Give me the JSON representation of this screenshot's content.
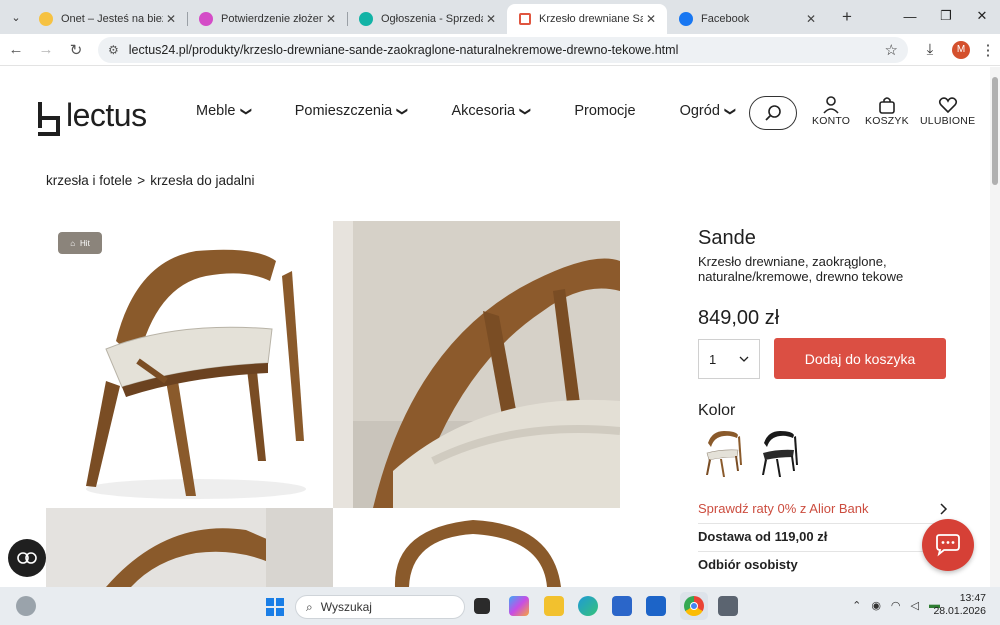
{
  "browser": {
    "tabs": [
      {
        "title": "Onet – Jesteś na bieżąco",
        "favicon_color": "#f6c242",
        "active": false
      },
      {
        "title": "Potwierdzenie złożenia z",
        "favicon_color": "#d44cc7",
        "active": false
      },
      {
        "title": "Ogłoszenia - Sprzedam, k",
        "favicon_color": "#12b3a6",
        "active": false
      },
      {
        "title": "Krzesło drewniane Sande",
        "favicon_color": "#e0553f",
        "active": true
      },
      {
        "title": "Facebook",
        "favicon_color": "#1877f2",
        "active": false
      }
    ],
    "new_tab_glyph": "+",
    "url": "lectus24.pl/produkty/krzeslo-drewniane-sande-zaokraglone-naturalnekremowe-drewno-tekowe.html",
    "profile_initial": "M"
  },
  "site": {
    "logo_text": "lectus",
    "nav": [
      {
        "label": "Meble",
        "dropdown": true
      },
      {
        "label": "Pomieszczenia",
        "dropdown": true
      },
      {
        "label": "Akcesoria",
        "dropdown": true
      },
      {
        "label": "Promocje",
        "dropdown": false
      },
      {
        "label": "Ogród",
        "dropdown": true
      }
    ],
    "account_label": "KONTO",
    "cart_label": "KOSZYK",
    "favorites_label": "ULUBIONE"
  },
  "breadcrumb": {
    "items": [
      "krzesła i fotele",
      "krzesła do jadalni"
    ],
    "separator": ">"
  },
  "gallery": {
    "badge": "Hit"
  },
  "product": {
    "name": "Sande",
    "subtitle": "Krzesło drewniane, zaokrąglone, naturalne/kremowe, drewno tekowe",
    "price": "849,00 zł",
    "quantity": "1",
    "add_to_cart_label": "Dodaj do koszyka",
    "color_heading": "Kolor",
    "color_options": [
      "natural",
      "black"
    ],
    "installment_text": "Sprawdź raty 0% z Alior Bank",
    "delivery_text": "Dostawa od 119,00 zł",
    "pickup_text": "Odbiór osobisty"
  },
  "taskbar": {
    "search_placeholder": "Wyszukaj",
    "time": "13:47",
    "date": "28.01.2026"
  },
  "colors": {
    "accent": "#db4f43",
    "alior": "#cc4d3f",
    "chat": "#d64036",
    "badge_bg": "#8b847b"
  }
}
